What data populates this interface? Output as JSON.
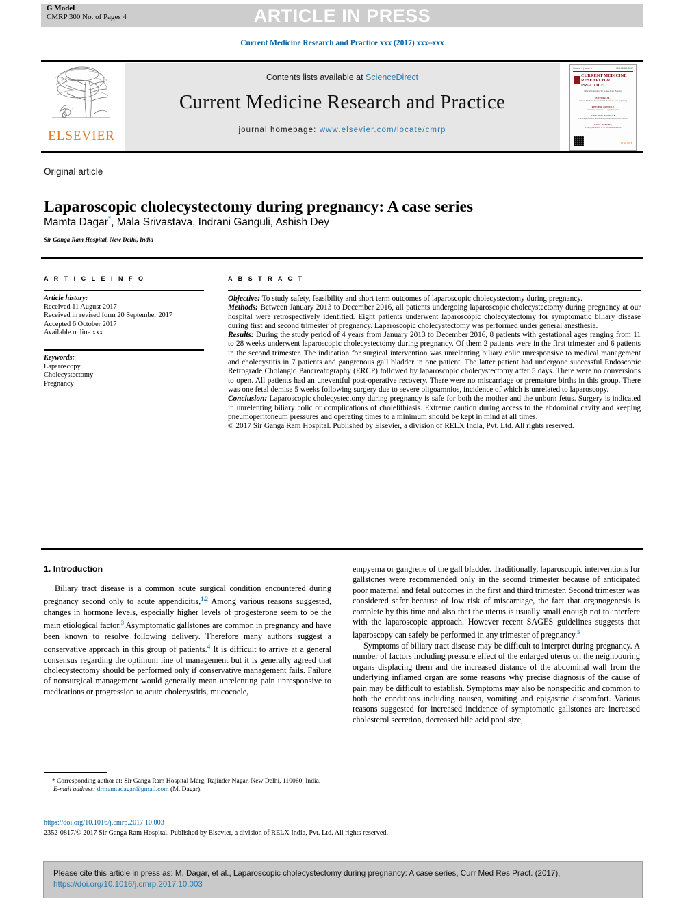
{
  "header": {
    "gmodel_line1": "G Model",
    "gmodel_line2": "CMRP 300 No. of Pages 4",
    "article_in_press": "ARTICLE IN PRESS",
    "running_head": "Current Medicine Research and Practice xxx (2017) xxx–xxx"
  },
  "masthead": {
    "contents_prefix": "Contents lists available at ",
    "contents_link": "ScienceDirect",
    "journal_title": "Current Medicine Research and Practice",
    "homepage_label": "journal homepage: ",
    "homepage_url": "www.elsevier.com/locate/cmrp",
    "publisher_logo_word": "ELSEVIER",
    "cover": {
      "issn_left": "Volume 1 | Issue 1",
      "issn_right": "ISSN 2352-0817",
      "title_line1": "CURRENT MEDICINE",
      "title_line2": "RESEARCH & PRACTICE",
      "subtitle": "Official Journal of Sir Ganga Ram Hospital",
      "sections": [
        {
          "heading": "EDITORIAL",
          "lines": "Current Medicine Research and Practice: a new beginning"
        },
        {
          "heading": "REVIEW ARTICLE",
          "lines": "Antibiotic resistance — a global threat"
        },
        {
          "heading": "ORIGINAL ARTICLE",
          "lines": "Clinical profile and outcome of patients admitted in the ICU"
        },
        {
          "heading": "CASE REPORT",
          "lines": "A rare presentation of an uncommon disease"
        }
      ],
      "brand": "ELSEVIER"
    }
  },
  "article": {
    "kicker": "Original article",
    "title": "Laparoscopic cholecystectomy during pregnancy: A case series",
    "authors_pre": "Mamta Dagar",
    "authors_star": "*",
    "authors_post": ", Mala Srivastava, Indrani Ganguli, Ashish Dey",
    "affiliation": "Sir Ganga Ram Hospital, New Delhi, India"
  },
  "article_info": {
    "heading": "A R T I C L E   I N F O",
    "history_label": "Article history:",
    "history": [
      "Received 11 August 2017",
      "Received in revised form 20 September 2017",
      "Accepted 6 October 2017",
      "Available online xxx"
    ],
    "keywords_label": "Keywords:",
    "keywords": [
      "Laparoscopy",
      "Cholecystectomy",
      "Pregnancy"
    ]
  },
  "abstract": {
    "heading": "A B S T R A C T",
    "objective_label": "Objective:",
    "objective_text": " To study safety, feasibility and short term outcomes of laparoscopic cholecystectomy during pregnancy.",
    "methods_label": "Methods:",
    "methods_text": " Between January 2013 to December 2016, all patients undergoing laparoscopic cholecystectomy during pregnancy at our hospital were retrospectively identified. Eight patients underwent laparoscopic cholecystectomy for symptomatic biliary disease during first and second trimester of pregnancy. Laparoscopic cholecystectomy was performed under general anesthesia.",
    "results_label": "Results:",
    "results_text": " During the study period of 4 years from January 2013 to December 2016, 8 patients with gestational ages ranging from 11 to 28 weeks underwent laparoscopic cholecystectomy during pregnancy. Of them 2 patients were in the first trimester and 6 patients in the second trimester. The indication for surgical intervention was unrelenting biliary colic unresponsive to medical management and cholecystitis in 7 patients and gangrenous gall bladder in one patient. The latter patient had undergone successful Endoscopic Retrograde Cholangio Pancreatography (ERCP) followed by laparoscopic cholecystectomy after 5 days. There were no conversions to open. All patients had an uneventful post-operative recovery. There were no miscarriage or premature births in this group. There was one fetal demise 5 weeks following surgery due to severe oligoamnios, incidence of which is unrelated to laparoscopy.",
    "conclusion_label": "Conclusion:",
    "conclusion_text": " Laparoscopic cholecystectomy during pregnancy is safe for both the mother and the unborn fetus. Surgery is indicated in unrelenting biliary colic or complications of cholelithiasis. Extreme caution during access to the abdominal cavity and keeping pneumoperitoneum pressures and operating times to a minimum should be kept in mind at all times.",
    "copyright": "© 2017 Sir Ganga Ram Hospital. Published by Elsevier, a division of RELX India, Pvt. Ltd. All rights reserved."
  },
  "body": {
    "section1_heading": "1. Introduction",
    "left_p1_a": "Biliary tract disease is a common acute surgical condition encountered during pregnancy second only to acute appendicitis,",
    "left_p1_ref1": "1,2",
    "left_p1_b": " Among various reasons suggested, changes in hormone levels, especially higher levels of progesterone seem to be the main etiological factor.",
    "left_p1_ref2": "3",
    "left_p1_c": " Asymptomatic gallstones are common in pregnancy and have been known to resolve following delivery. Therefore many authors suggest a conservative approach in this group of patients.",
    "left_p1_ref3": "4",
    "left_p1_d": " It is difficult to arrive at a general consensus regarding the optimum line of management but it is generally agreed that cholecystectomy should be performed only if conservative management fails. Failure of nonsurgical management would generally mean unrelenting pain unresponsive to medications or progression to acute cholecystitis, mucocoele,",
    "right_p1_a": "empyema or gangrene of the gall bladder. Traditionally, laparoscopic interventions for gallstones were recommended only in the second trimester because of anticipated poor maternal and fetal outcomes in the first and third trimester. Second trimester was considered safer because of low risk of miscarriage, the fact that organogenesis is complete by this time and also that the uterus is usually small enough not to interfere with the laparoscopic approach. However recent SAGES guidelines suggests that laparoscopy can safely be performed in any trimester of pregnancy.",
    "right_p1_ref": "5",
    "right_p2": "Symptoms of biliary tract disease may be difficult to interpret during pregnancy. A number of factors including pressure effect of the enlarged uterus on the neighbouring organs displacing them and the increased distance of the abdominal wall from the underlying inflamed organ are some reasons why precise diagnosis of the cause of pain may be difficult to establish. Symptoms may also be nonspecific and common to both the conditions including nausea, vomiting and epigastric discomfort. Various reasons suggested for increased incidence of symptomatic gallstones are increased cholesterol secretion, decreased bile acid pool size,"
  },
  "footnote": {
    "star": "*",
    "corresponding": " Corresponding author at: Sir Ganga Ram Hospital Marg, Rajinder Nagar, New Delhi, 110060, India.",
    "email_label": "E-mail address:",
    "email": "drmamtadagar@gmail.com",
    "email_suffix": " (M. Dagar).",
    "doi": "https://doi.org/10.1016/j.cmrp.2017.10.003",
    "issn_copyright": "2352-0817/© 2017 Sir Ganga Ram Hospital. Published by Elsevier, a division of RELX India, Pvt. Ltd. All rights reserved."
  },
  "citation": {
    "text": "Please cite this article in press as: M. Dagar, et al., Laparoscopic cholecystectomy during pregnancy: A case series, Curr Med Res Pract. (2017),",
    "link": "https://doi.org/10.1016/j.cmrp.2017.10.003"
  },
  "colors": {
    "link_blue": "#2a7ab0",
    "head_blue": "#0a64a4",
    "elsevier_orange": "#e87722",
    "banner_grey": "#cdcdcd",
    "mast_grey": "#e6e6e6",
    "cite_grey": "#c9c9c9"
  }
}
